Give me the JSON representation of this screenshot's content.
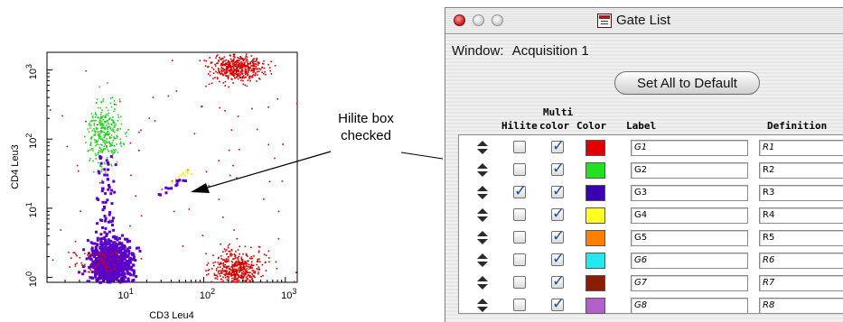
{
  "plot": {
    "y_axis_label": "CD4 Leu3",
    "x_axis_label": "CD3 Leu4",
    "x_ticks": [
      {
        "base": "10",
        "exp": "1",
        "value": 10
      },
      {
        "base": "10",
        "exp": "2",
        "value": 100
      },
      {
        "base": "10",
        "exp": "3",
        "value": 1000
      }
    ],
    "y_ticks": [
      {
        "base": "10",
        "exp": "0",
        "value": 1
      },
      {
        "base": "10",
        "exp": "1",
        "value": 10
      },
      {
        "base": "10",
        "exp": "2",
        "value": 100
      },
      {
        "base": "10",
        "exp": "3",
        "value": 1000
      }
    ],
    "axis_range": {
      "x": [
        1.2,
        1400
      ],
      "y": [
        0.85,
        1800
      ]
    },
    "scale": "log-log",
    "populations": [
      {
        "color": "#d40000",
        "center": [
          250,
          1100
        ]
      },
      {
        "color": "#20d020",
        "center": [
          6,
          120
        ]
      },
      {
        "color": "#5a00c8",
        "center": [
          7,
          1.7
        ]
      },
      {
        "color": "#f4ea30",
        "center": [
          40,
          25
        ]
      },
      {
        "color": "#d40000",
        "center": [
          250,
          1.3
        ]
      }
    ]
  },
  "callout": {
    "line1": "Hilite box",
    "line2": "checked"
  },
  "window": {
    "title": "Gate List",
    "window_field_label": "Window:",
    "window_field_value": "Acquisition 1",
    "default_button": "Set All to Default",
    "columns": {
      "hilite": "Hilite",
      "multi_color_top": "Multi",
      "multi_color_bottom": "color",
      "color": "Color",
      "label": "Label",
      "definition": "Definition"
    },
    "gates": [
      {
        "hilite": false,
        "multicolor": true,
        "color": "#e00000",
        "label": "G1",
        "definition": "R1",
        "italic": true
      },
      {
        "hilite": false,
        "multicolor": true,
        "color": "#22e022",
        "label": "G2",
        "definition": "R2",
        "italic": false
      },
      {
        "hilite": true,
        "multicolor": true,
        "color": "#3a00b0",
        "label": "G3",
        "definition": "R3",
        "italic": false
      },
      {
        "hilite": false,
        "multicolor": true,
        "color": "#ffff20",
        "label": "G4",
        "definition": "R4",
        "italic": false
      },
      {
        "hilite": false,
        "multicolor": true,
        "color": "#ff7f00",
        "label": "G5",
        "definition": "R5",
        "italic": false
      },
      {
        "hilite": false,
        "multicolor": true,
        "color": "#22e8f0",
        "label": "G6",
        "definition": "R6",
        "italic": true
      },
      {
        "hilite": false,
        "multicolor": true,
        "color": "#8a1e00",
        "label": "G7",
        "definition": "R7",
        "italic": true
      },
      {
        "hilite": false,
        "multicolor": true,
        "color": "#b060c8",
        "label": "G8",
        "definition": "R8",
        "italic": true
      }
    ]
  }
}
